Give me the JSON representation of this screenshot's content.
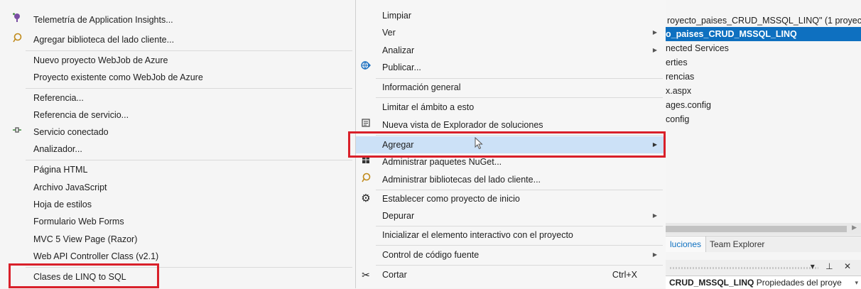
{
  "submenu": {
    "items": [
      {
        "label": "Telemetría de Application Insights...",
        "icon": "telemetry-icon"
      },
      {
        "label": "Agregar biblioteca del lado cliente...",
        "icon": "client-library-icon"
      },
      {
        "label": "Nuevo proyecto WebJob de Azure"
      },
      {
        "label": "Proyecto existente como WebJob de Azure"
      },
      {
        "label": "Referencia..."
      },
      {
        "label": "Referencia de servicio..."
      },
      {
        "label": "Servicio conectado",
        "icon": "connected-service-icon"
      },
      {
        "label": "Analizador..."
      },
      {
        "label": "Página HTML"
      },
      {
        "label": "Archivo JavaScript"
      },
      {
        "label": "Hoja de estilos"
      },
      {
        "label": "Formulario Web Forms"
      },
      {
        "label": "MVC 5 View Page (Razor)"
      },
      {
        "label": "Web API Controller Class (v2.1)"
      },
      {
        "label": "Clases de LINQ to SQL"
      }
    ]
  },
  "context_menu": {
    "items": [
      {
        "label": "Limpiar"
      },
      {
        "label": "Ver"
      },
      {
        "label": "Analizar"
      },
      {
        "label": "Publicar...",
        "icon": "publish-globe-icon"
      },
      {
        "label": "Información general"
      },
      {
        "label": "Limitar el ámbito a esto"
      },
      {
        "label": "Nueva vista de Explorador de soluciones",
        "icon": "new-view-icon"
      },
      {
        "label": "Agregar"
      },
      {
        "label": "Administrar paquetes NuGet...",
        "icon": "nuget-icon"
      },
      {
        "label": "Administrar bibliotecas del lado cliente...",
        "icon": "client-library-icon"
      },
      {
        "label": "Establecer como proyecto de inicio",
        "icon": "gear-icon"
      },
      {
        "label": "Depurar"
      },
      {
        "label": "Inicializar el elemento interactivo con el proyecto"
      },
      {
        "label": "Control de código fuente"
      },
      {
        "label": "Cortar",
        "icon": "scissors-icon",
        "shortcut": "Ctrl+X"
      }
    ]
  },
  "explorer": {
    "tree": [
      {
        "text": "royecto_paises_CRUD_MSSQL_LINQ\" (1 proyect"
      },
      {
        "text": "o_paises_CRUD_MSSQL_LINQ",
        "selected": true
      },
      {
        "text": "nected Services"
      },
      {
        "text": "erties"
      },
      {
        "text": "rencias"
      },
      {
        "text": "x.aspx"
      },
      {
        "text": "ages.config"
      },
      {
        "text": "config"
      }
    ],
    "tabs": [
      "luciones",
      "Team Explorer"
    ],
    "panel_controls": "▾ ⊥ ✕",
    "properties_bold": "CRUD_MSSQL_LINQ",
    "properties_rest": "Propiedades del proye"
  },
  "colors": {
    "highlight": "#cce1f7",
    "selection": "#0e70c0",
    "annotation_red": "#d9202a"
  }
}
